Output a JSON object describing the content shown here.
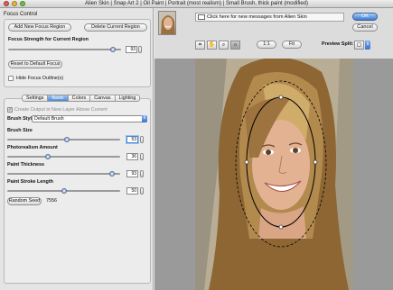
{
  "window": {
    "title": "Alien Skin | Snap Art 2 | Oil Paint | Portrait (most realism) | Small Brush, thick paint (modified)"
  },
  "focus": {
    "title": "Focus Control",
    "add_label": "Add New Focus Region",
    "delete_label": "Delete Current Region",
    "strength_label": "Focus Strength for Current Region",
    "strength_value": "93",
    "strength_level": 0.93,
    "reset_label": "Reset to Default Focus",
    "hide_label": "Hide Focus Outline(s)"
  },
  "tabs": [
    "Settings",
    "Basic",
    "Colors",
    "Canvas",
    "Lighting"
  ],
  "basic": {
    "create_layer_label": "Create Output in New Layer Above Current",
    "brush_style_label": "Brush Style",
    "brush_style_value": "Default Brush",
    "brush_size_label": "Brush Size",
    "brush_size_value": "53",
    "brush_size_level": 0.53,
    "photorealism_label": "Photorealism Amount",
    "photorealism_value": "36",
    "photorealism_level": 0.36,
    "paint_thickness_label": "Paint Thickness",
    "paint_thickness_value": "93",
    "paint_thickness_level": 0.93,
    "stroke_length_label": "Paint Stroke Length",
    "stroke_length_value": "50",
    "stroke_length_level": 0.5,
    "random_seed_label": "Random Seed",
    "random_seed_value": "7556"
  },
  "top": {
    "message": "Click here for new messages from Alien Skin",
    "ok_label": "OK",
    "cancel_label": "Cancel",
    "zoom_1_label": "1:1",
    "fit_label": "Fit",
    "preview_split_label": "Preview Split:"
  },
  "icons": [
    "crop-icon",
    "hand-icon",
    "zoom-icon",
    "sun-icon",
    "split-icon",
    "mail-icon"
  ],
  "colors": {
    "accent": "#4f8ad6",
    "canvas": "#9a9a9a"
  }
}
